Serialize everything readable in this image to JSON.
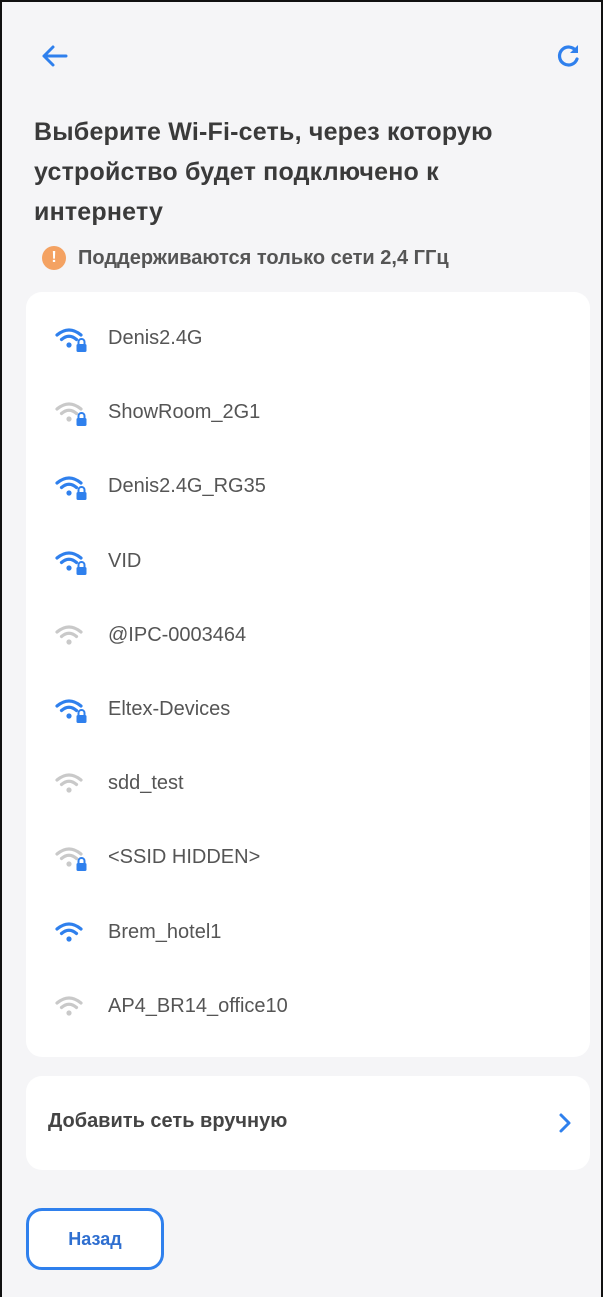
{
  "colors": {
    "accent": "#2f80ed",
    "wifi_strong": "#2f80ed",
    "wifi_weak": "#c9c9c9",
    "notice": "#f4a262"
  },
  "header": {
    "back_icon": "arrow-left-icon",
    "refresh_icon": "refresh-icon",
    "title": "Выберите Wi-Fi-сеть, через которую устройство будет подключено к интернету"
  },
  "notice": {
    "icon": "info-icon",
    "icon_glyph": "!",
    "text": "Поддерживаются только сети 2,4 ГГц"
  },
  "networks": [
    {
      "ssid": "Denis2.4G",
      "signal": "strong",
      "locked": true
    },
    {
      "ssid": "ShowRoom_2G1",
      "signal": "weak",
      "locked": true
    },
    {
      "ssid": "Denis2.4G_RG35",
      "signal": "strong",
      "locked": true
    },
    {
      "ssid": "VID",
      "signal": "strong",
      "locked": true
    },
    {
      "ssid": "@IPC-0003464",
      "signal": "weak",
      "locked": false
    },
    {
      "ssid": "Eltex-Devices",
      "signal": "strong",
      "locked": true
    },
    {
      "ssid": "sdd_test",
      "signal": "weak",
      "locked": false
    },
    {
      "ssid": "<SSID HIDDEN>",
      "signal": "weak",
      "locked": true
    },
    {
      "ssid": "Brem_hotel1",
      "signal": "strong",
      "locked": false
    },
    {
      "ssid": "AP4_BR14_office10",
      "signal": "weak",
      "locked": false
    }
  ],
  "add_network": {
    "label": "Добавить сеть вручную",
    "icon": "chevron-right-icon"
  },
  "footer": {
    "back_label": "Назад"
  }
}
